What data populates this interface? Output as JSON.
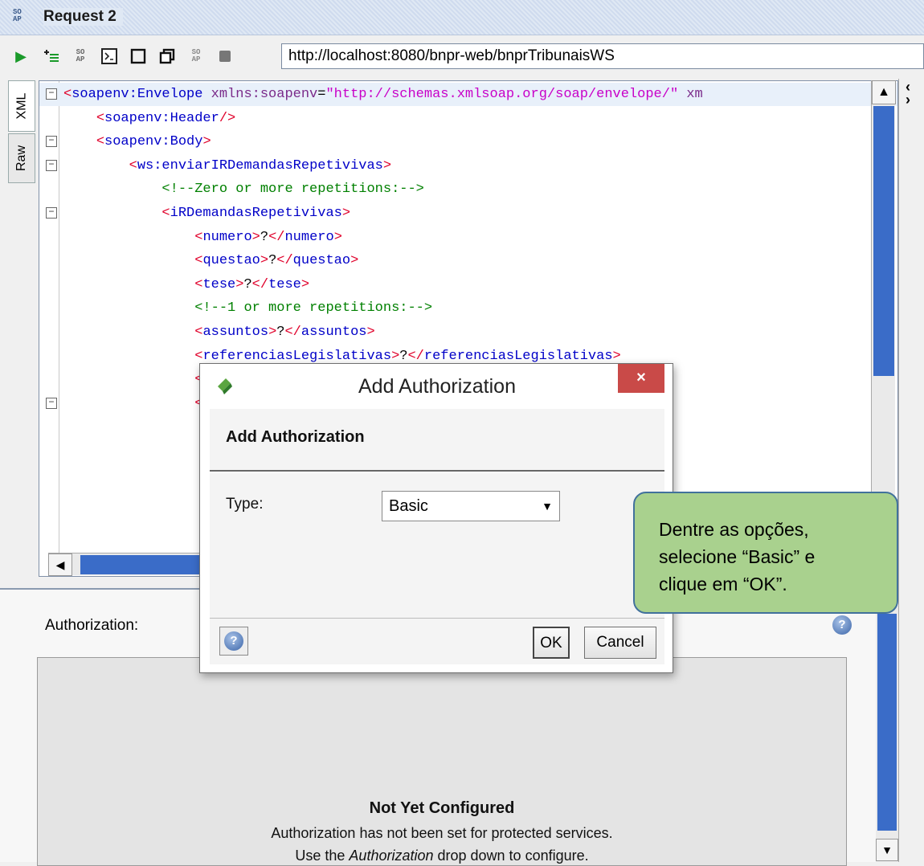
{
  "window": {
    "title": "Request 2",
    "soap_badge": "SO\nAP"
  },
  "toolbar": {
    "endpoint_url": "http://localhost:8080/bnpr-web/bnprTribunaisWS"
  },
  "editor": {
    "tabs": [
      "XML",
      "Raw"
    ],
    "lines": [
      {
        "indent": "",
        "parts": [
          [
            "tag",
            "<"
          ],
          [
            "tagname",
            "soapenv:Envelope"
          ],
          [
            "attr",
            " xmlns:soapenv"
          ],
          [
            "text",
            "="
          ],
          [
            "str",
            "\"http://schemas.xmlsoap.org/soap/envelope/\""
          ],
          [
            "attr",
            " xm"
          ]
        ]
      },
      {
        "indent": "    ",
        "parts": [
          [
            "tag",
            "<"
          ],
          [
            "tagname",
            "soapenv:Header"
          ],
          [
            "tag",
            "/>"
          ]
        ]
      },
      {
        "indent": "    ",
        "parts": [
          [
            "tag",
            "<"
          ],
          [
            "tagname",
            "soapenv:Body"
          ],
          [
            "tag",
            ">"
          ]
        ]
      },
      {
        "indent": "        ",
        "parts": [
          [
            "tag",
            "<"
          ],
          [
            "tagname",
            "ws:enviarIRDemandasRepetivivas"
          ],
          [
            "tag",
            ">"
          ]
        ]
      },
      {
        "indent": "            ",
        "parts": [
          [
            "comment",
            "<!--Zero or more repetitions:-->"
          ]
        ]
      },
      {
        "indent": "            ",
        "parts": [
          [
            "tag",
            "<"
          ],
          [
            "tagname",
            "iRDemandasRepetivivas"
          ],
          [
            "tag",
            ">"
          ]
        ]
      },
      {
        "indent": "                ",
        "parts": [
          [
            "tag",
            "<"
          ],
          [
            "tagname",
            "numero"
          ],
          [
            "tag",
            ">"
          ],
          [
            "text",
            "?"
          ],
          [
            "tag",
            "</"
          ],
          [
            "tagname",
            "numero"
          ],
          [
            "tag",
            ">"
          ]
        ]
      },
      {
        "indent": "                ",
        "parts": [
          [
            "tag",
            "<"
          ],
          [
            "tagname",
            "questao"
          ],
          [
            "tag",
            ">"
          ],
          [
            "text",
            "?"
          ],
          [
            "tag",
            "</"
          ],
          [
            "tagname",
            "questao"
          ],
          [
            "tag",
            ">"
          ]
        ]
      },
      {
        "indent": "                ",
        "parts": [
          [
            "tag",
            "<"
          ],
          [
            "tagname",
            "tese"
          ],
          [
            "tag",
            ">"
          ],
          [
            "text",
            "?"
          ],
          [
            "tag",
            "</"
          ],
          [
            "tagname",
            "tese"
          ],
          [
            "tag",
            ">"
          ]
        ]
      },
      {
        "indent": "                ",
        "parts": [
          [
            "comment",
            "<!--1 or more repetitions:-->"
          ]
        ]
      },
      {
        "indent": "                ",
        "parts": [
          [
            "tag",
            "<"
          ],
          [
            "tagname",
            "assuntos"
          ],
          [
            "tag",
            ">"
          ],
          [
            "text",
            "?"
          ],
          [
            "tag",
            "</"
          ],
          [
            "tagname",
            "assuntos"
          ],
          [
            "tag",
            ">"
          ]
        ]
      },
      {
        "indent": "                ",
        "parts": [
          [
            "tag",
            "<"
          ],
          [
            "tagname",
            "referenciasLegislativas"
          ],
          [
            "tag",
            ">"
          ],
          [
            "text",
            "?"
          ],
          [
            "tag",
            "</"
          ],
          [
            "tagname",
            "referenciasLegislativas"
          ],
          [
            "tag",
            ">"
          ]
        ]
      },
      {
        "indent": "                ",
        "parts": [
          [
            "tag",
            "<"
          ]
        ]
      },
      {
        "indent": "                ",
        "parts": [
          [
            "tag",
            "<"
          ]
        ]
      }
    ]
  },
  "auth_panel": {
    "label": "Authorization:",
    "help_glyph": "?",
    "status_title": "Not Yet Configured",
    "status_line1": "Authorization has not been set for protected services.",
    "status_line2": "Use the Authorization drop down to configure."
  },
  "dialog": {
    "title": "Add Authorization",
    "close_glyph": "×",
    "header": "Add Authorization",
    "type_label": "Type:",
    "type_value": "Basic",
    "ok_label": "OK",
    "cancel_label": "Cancel"
  },
  "callout": {
    "text_line1": "Dentre as opções,",
    "text_line2": "selecione “Basic” e",
    "text_line3": "clique em “OK”."
  },
  "colors": {
    "scroll_thumb": "#3a6cc8",
    "close_button": "#c94a48",
    "callout_fill": "#a9d18e",
    "callout_border": "#41719c"
  }
}
